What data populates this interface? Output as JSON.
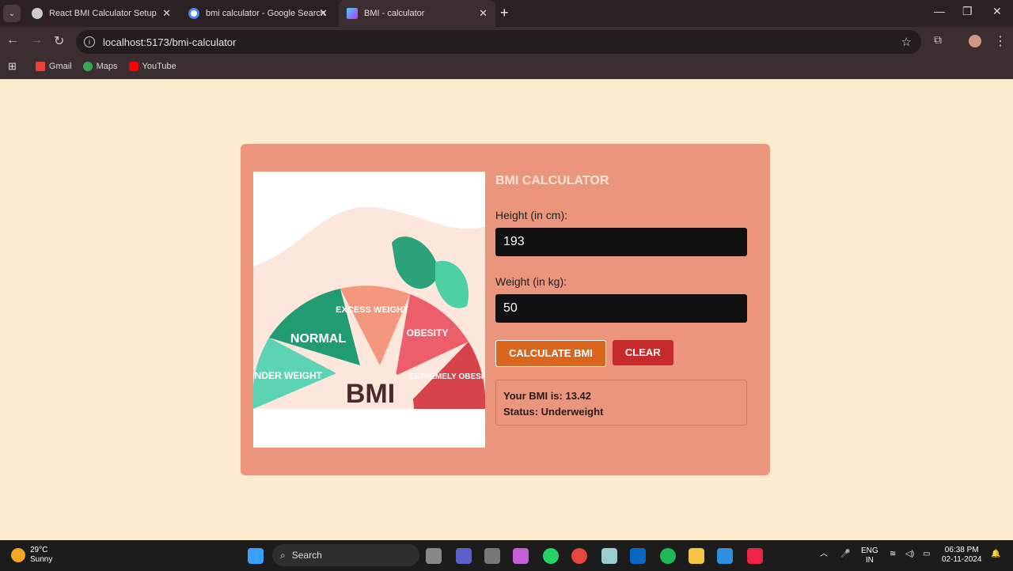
{
  "browser": {
    "tabs": [
      {
        "title": "React BMI Calculator Setup",
        "active": false
      },
      {
        "title": "bmi calculator - Google Search",
        "active": false
      },
      {
        "title": "BMI - calculator",
        "active": true
      }
    ],
    "url": "localhost:5173/bmi-calculator",
    "bookmarks": [
      "Gmail",
      "Maps",
      "YouTube"
    ]
  },
  "illustration": {
    "segments": [
      "UNDER WEIGHT",
      "NORMAL",
      "EXCESS WEIGHT",
      "OBESITY",
      "EXTREMELY OBESITY"
    ],
    "center_label": "BMI"
  },
  "calculator": {
    "title": "BMI CALCULATOR",
    "height_label": "Height (in cm):",
    "height_value": "193",
    "weight_label": "Weight (in kg):",
    "weight_value": "50",
    "calculate_label": "CALCULATE BMI",
    "clear_label": "CLEAR",
    "result_bmi": "Your BMI is: 13.42",
    "result_status": "Status: Underweight"
  },
  "taskbar": {
    "temperature": "29°C",
    "weather": "Sunny",
    "search_placeholder": "Search",
    "lang": "ENG",
    "region": "IN",
    "time": "06:38 PM",
    "date": "02-11-2024"
  },
  "colors": {
    "page_bg": "#fdebd0",
    "card_bg": "#eb967c",
    "calc_btn": "#d9661c",
    "clear_btn": "#c62a2a"
  }
}
